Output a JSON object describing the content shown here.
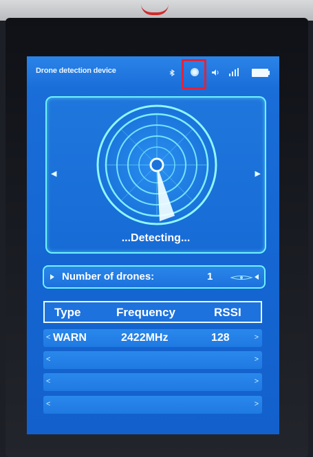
{
  "app": {
    "title": "Drone detection device"
  },
  "status_icons": [
    "bluetooth-icon",
    "record-dot-icon",
    "speaker-icon",
    "signal-icon",
    "battery-icon"
  ],
  "radar": {
    "status_text": "...Detecting..."
  },
  "drone_count": {
    "label": "Number of drones:",
    "value": "1"
  },
  "table": {
    "headers": [
      "Type",
      "Frequency",
      "RSSI"
    ],
    "rows": [
      {
        "type": "WARN",
        "frequency": "2422MHz",
        "rssi": "128"
      },
      {
        "type": "",
        "frequency": "",
        "rssi": ""
      },
      {
        "type": "",
        "frequency": "",
        "rssi": ""
      },
      {
        "type": "",
        "frequency": "",
        "rssi": ""
      }
    ],
    "prev_glyph": "<",
    "next_glyph": ">"
  },
  "colors": {
    "screen_blue": "#1567d3",
    "accent_cyan": "#6ef3ff",
    "highlight_red": "#e0233a"
  }
}
